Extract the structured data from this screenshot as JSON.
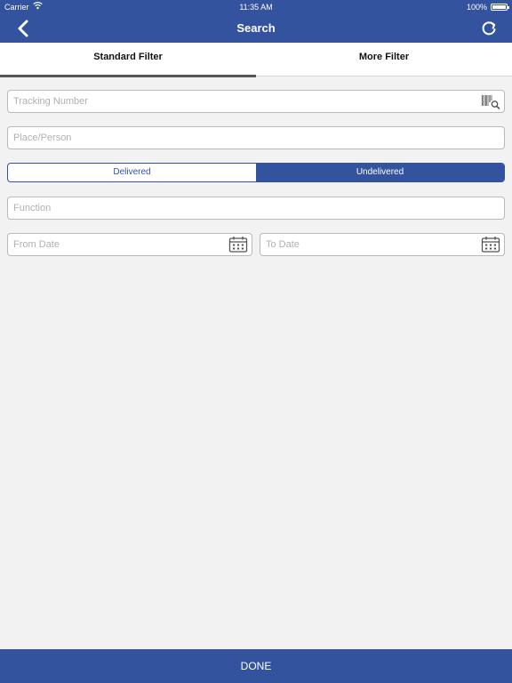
{
  "status_bar": {
    "carrier": "Carrier",
    "time": "11:35 AM",
    "battery": "100%"
  },
  "nav": {
    "title": "Search"
  },
  "tabs": [
    {
      "label": "Standard Filter",
      "active": true
    },
    {
      "label": "More Filter",
      "active": false
    }
  ],
  "fields": {
    "tracking_number": {
      "placeholder": "Tracking Number",
      "value": ""
    },
    "place_person": {
      "placeholder": "Place/Person",
      "value": ""
    },
    "function": {
      "placeholder": "Function",
      "value": ""
    },
    "from_date": {
      "placeholder": "From Date",
      "value": ""
    },
    "to_date": {
      "placeholder": "To Date",
      "value": ""
    }
  },
  "delivery_toggle": {
    "options": [
      "Delivered",
      "Undelivered"
    ],
    "selected": "Undelivered"
  },
  "done_label": "DONE",
  "colors": {
    "primary": "#33539e",
    "background": "#f2f2f2"
  }
}
